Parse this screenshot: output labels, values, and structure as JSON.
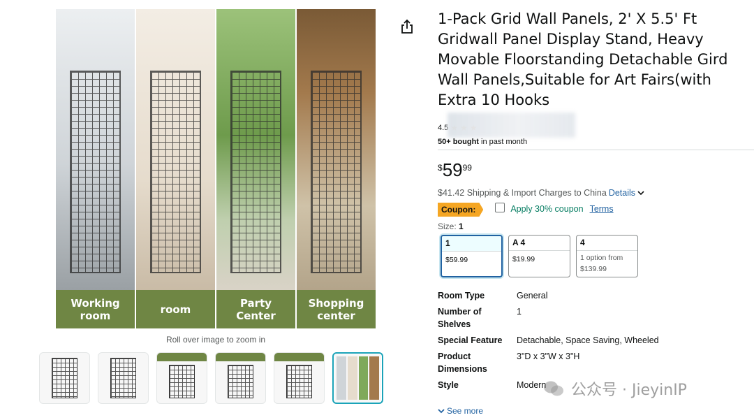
{
  "gallery": {
    "panels": [
      {
        "caption": "Working\nroom"
      },
      {
        "caption": "room"
      },
      {
        "caption": "Party\nCenter"
      },
      {
        "caption": "Shopping\ncenter"
      }
    ],
    "zoom_hint": "Roll over image to zoom in",
    "thumbnails": [
      {
        "label": "",
        "selected": false
      },
      {
        "label": "",
        "selected": false
      },
      {
        "label": "",
        "selected": false
      },
      {
        "label": "",
        "selected": false
      },
      {
        "label": "",
        "selected": false
      },
      {
        "label": "",
        "selected": true
      }
    ],
    "caption_color": "#6f8644",
    "selected_color": "#1ba3b8"
  },
  "product": {
    "title": "1-Pack Grid Wall Panels, 2' X 5.5' Ft Gridwall Panel Display Stand, Heavy Movable Floorstanding Detachable Gird Wall Panels,Suitable for Art Fairs(with Extra 10 Hooks",
    "rating_value": "4.5",
    "bought_count": "50+ bought",
    "bought_suffix": "in past month",
    "price_symbol": "$",
    "price_whole": "59",
    "price_fraction": "99",
    "shipping_text": "$41.42 Shipping & Import Charges to China",
    "shipping_details_link": "Details",
    "coupon": {
      "badge": "Coupon:",
      "text": "Apply 30% coupon",
      "terms": "Terms",
      "badge_color": "#f5a623"
    },
    "size": {
      "label": "Size:",
      "selected": "1",
      "options": [
        {
          "name": "1",
          "detail": "$59.99",
          "selected": true
        },
        {
          "name": "A 4",
          "detail": "$19.99",
          "selected": false
        },
        {
          "name": "4",
          "detail_line1": "1 option from",
          "detail_line2": "$139.99",
          "selected": false
        }
      ]
    },
    "specs": [
      {
        "key": "Room Type",
        "value": "General"
      },
      {
        "key": "Number of Shelves",
        "value": "1"
      },
      {
        "key": "Special Feature",
        "value": "Detachable, Space Saving, Wheeled"
      },
      {
        "key": "Product Dimensions",
        "value": "3\"D x 3\"W x 3\"H"
      },
      {
        "key": "Style",
        "value": "Modern"
      }
    ],
    "see_more": "See more"
  },
  "watermark": {
    "brand": "公众号 · JieyinIP"
  },
  "colors": {
    "link": "#2162a1",
    "coupon_text": "#067d62",
    "star": "#de7921"
  },
  "icons": [
    "share-icon",
    "chevron-down-icon",
    "star-icon",
    "wechat-icon"
  ]
}
